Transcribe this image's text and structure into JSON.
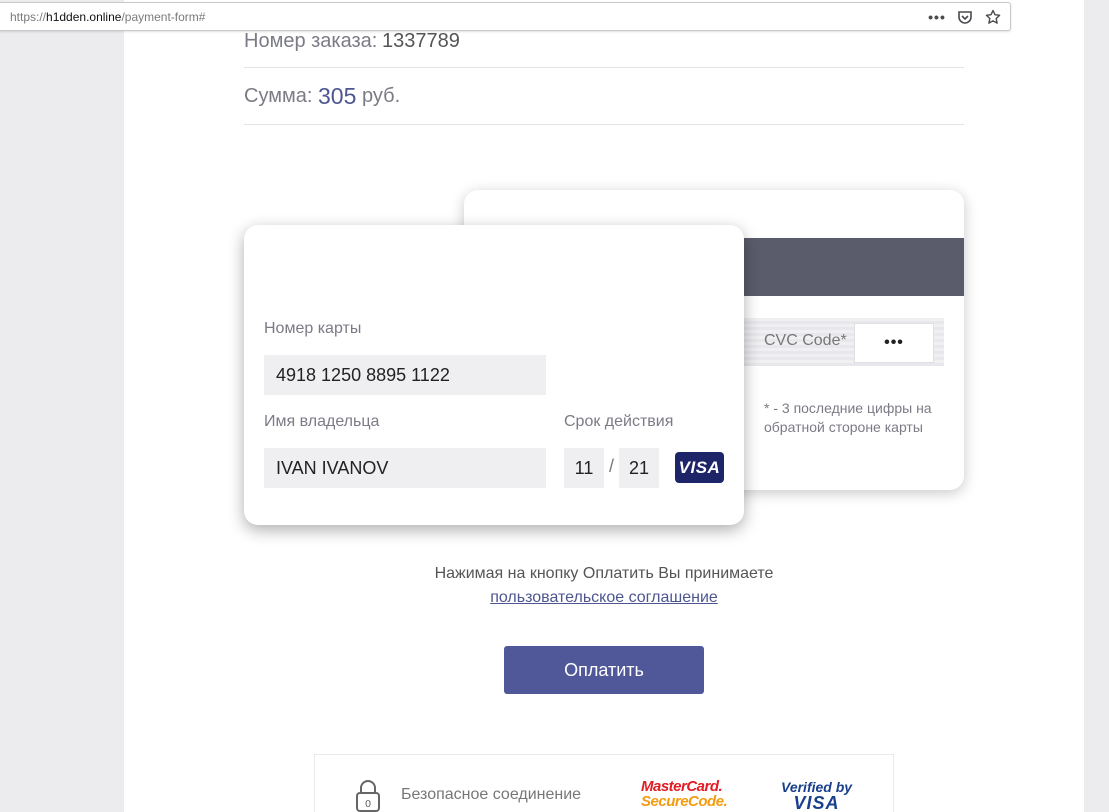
{
  "browser": {
    "url_prefix": "https://",
    "url_host": "h1dden.online",
    "url_path": "/payment-form#",
    "menu_icon": "dots-icon",
    "pocket_icon": "pocket-icon",
    "bookmark_icon": "star-icon"
  },
  "order": {
    "label": "Номер заказа:",
    "number": "1337789",
    "sum_label": "Сумма:",
    "sum_value": "305",
    "currency": "руб."
  },
  "card_back": {
    "cvc_label": "CVC Code*",
    "cvc_value": "•••",
    "cvc_note": "* - 3 последние цифры на обратной стороне карты"
  },
  "card_front": {
    "number_label": "Номер карты",
    "number_value": "4918 1250 8895 1122",
    "holder_label": "Имя владельца",
    "holder_value": "IVAN IVANOV",
    "expiry_label": "Срок действия",
    "expiry_month": "11",
    "expiry_separator": "/",
    "expiry_year": "21",
    "brand": "VISA"
  },
  "agreement": {
    "text": "Нажимая на кнопку Оплатить Вы принимаете",
    "link": "пользовательское соглашение"
  },
  "pay_button": "Оплатить",
  "security": {
    "lock_digit": "0",
    "text": "Безопасное соединение",
    "mastercard_line1": "MasterCard.",
    "mastercard_line2": "SecureCode.",
    "verified_line1": "Verified by",
    "verified_line2": "VISA"
  },
  "colors": {
    "accent": "#50589a",
    "strip": "#5a5c6c",
    "visa_badge": "#1d2568"
  }
}
